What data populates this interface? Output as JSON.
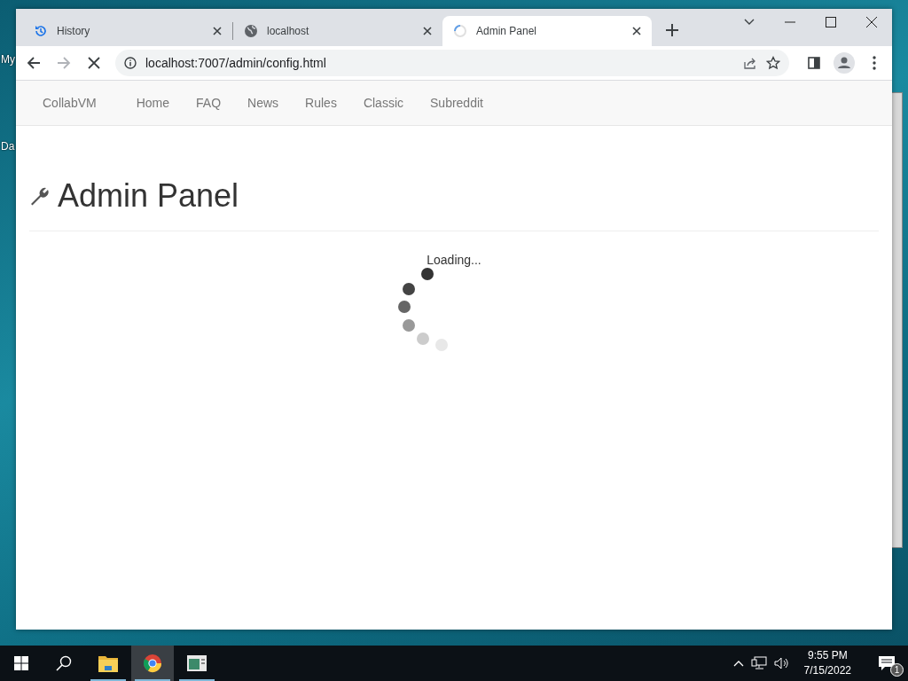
{
  "desktop": {
    "icon_labels": [
      "My",
      "Da"
    ]
  },
  "browser": {
    "tabs": [
      {
        "title": "History",
        "kind": "history",
        "selected": false
      },
      {
        "title": "localhost",
        "kind": "globe",
        "selected": false
      },
      {
        "title": "Admin Panel",
        "kind": "spinner",
        "selected": true
      }
    ],
    "address": "localhost:7007/admin/config.html",
    "loading": true
  },
  "page": {
    "brand": "CollabVM",
    "nav": [
      "Home",
      "FAQ",
      "News",
      "Rules",
      "Classic",
      "Subreddit"
    ],
    "heading": "Admin Panel",
    "status": "Loading..."
  },
  "taskbar": {
    "apps": [
      {
        "kind": "folder",
        "selected": false
      },
      {
        "kind": "chrome",
        "selected": true
      },
      {
        "kind": "window",
        "selected": false
      }
    ],
    "time": "9:55 PM",
    "date": "7/15/2022",
    "notifications": "1"
  }
}
